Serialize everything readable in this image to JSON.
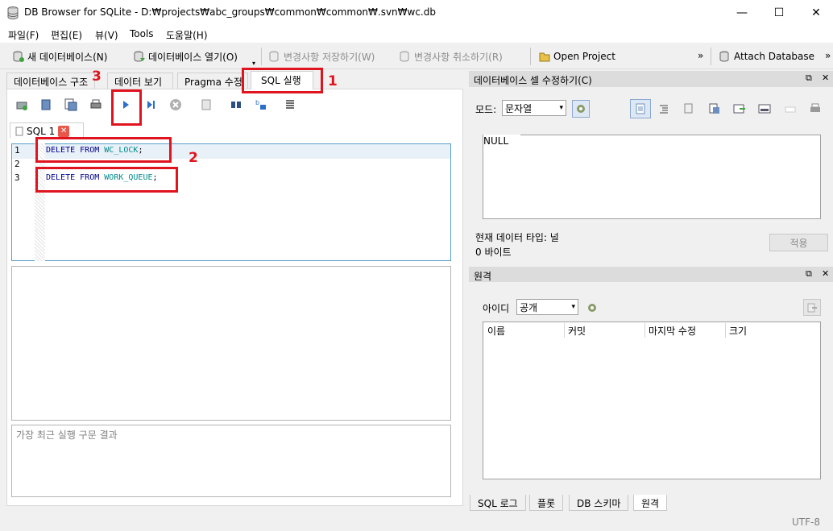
{
  "window": {
    "title": "DB Browser for SQLite - D:₩projects₩abc_groups₩common₩common₩.svn₩wc.db",
    "minimize": "—",
    "maximize": "☐",
    "close": "✕"
  },
  "menu": [
    "파일(F)",
    "편집(E)",
    "뷰(V)",
    "Tools",
    "도움말(H)"
  ],
  "toolbar": {
    "new_db": "새 데이터베이스(N)",
    "open_db": "데이터베이스 열기(O)",
    "write_changes": "변경사항 저장하기(W)",
    "revert_changes": "변경사항 취소하기(R)",
    "open_project": "Open Project",
    "attach_db": "Attach Database",
    "overflow": "»"
  },
  "tabs": [
    "데이터베이스 구조",
    "데이터 보기",
    "Pragma 수정",
    "SQL 실행"
  ],
  "sql_tab": {
    "label": "SQL 1"
  },
  "editor": {
    "line_numbers": [
      "1",
      "2",
      "3"
    ],
    "lines": [
      {
        "kw1": "DELETE",
        "kw2": "FROM",
        "table": "WC_LOCK",
        "end": ";"
      },
      {
        "kw1": "DELETE",
        "kw2": "FROM",
        "table": "WORK_QUEUE",
        "end": ";"
      }
    ]
  },
  "message_placeholder": "가장 최근 실행 구문 결과",
  "annotations": [
    "1",
    "2",
    "3"
  ],
  "edit_cell": {
    "title": "데이터베이스 셀 수정하기(C)",
    "mode_label": "모드:",
    "mode_value": "문자열",
    "cell_value": "NULL",
    "type_label": "현재 데이터 타입: 널",
    "size_label": "0 바이트",
    "apply": "적용"
  },
  "remote": {
    "title": "원격",
    "id_label": "아이디",
    "id_value": "공개",
    "columns": [
      "이름",
      "커밋",
      "마지막 수정",
      "크기"
    ]
  },
  "bottom_tabs": [
    "SQL 로그",
    "플롯",
    "DB 스키마",
    "원격"
  ],
  "status": {
    "encoding": "UTF-8"
  },
  "colors": {
    "annotation": "#e0141e",
    "keyword": "#00008b",
    "identifier": "#008b8b",
    "editor_border": "#5aa0c8"
  }
}
